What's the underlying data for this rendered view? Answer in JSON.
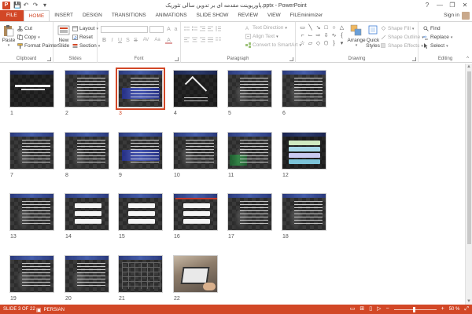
{
  "app": {
    "title": "پاورپوینت مقدمه ای بر تدوین سالی تئوریک.pptx - PowerPoint",
    "logo": "P",
    "signin": "Sign in"
  },
  "qat": {
    "save": "💾",
    "undo": "↶",
    "redo": "↷",
    "customize": "▾"
  },
  "window": {
    "help": "?",
    "minimize": "—",
    "restore": "❐",
    "close": "✕"
  },
  "tabs": [
    {
      "label": "FILE"
    },
    {
      "label": "HOME"
    },
    {
      "label": "INSERT"
    },
    {
      "label": "DESIGN"
    },
    {
      "label": "TRANSITIONS"
    },
    {
      "label": "ANIMATIONS"
    },
    {
      "label": "SLIDE SHOW"
    },
    {
      "label": "REVIEW"
    },
    {
      "label": "VIEW"
    },
    {
      "label": "FILEminimizer"
    }
  ],
  "ribbon": {
    "clipboard": {
      "label": "Clipboard",
      "paste": "Paste",
      "cut": "Cut",
      "copy": "Copy",
      "format_painter": "Format Painter"
    },
    "slides": {
      "label": "Slides",
      "new_slide": "New",
      "new_slide2": "Slide",
      "layout": "Layout",
      "reset": "Reset",
      "section": "Section"
    },
    "font": {
      "label": "Font",
      "bold": "B",
      "italic": "I",
      "underline": "U",
      "strike": "S",
      "shadow": "S",
      "spacing": "AV",
      "case": "Aa",
      "color": "A"
    },
    "paragraph": {
      "label": "Paragraph",
      "text_direction": "Text Direction",
      "align_text": "Align Text",
      "convert_smartart": "Convert to SmartArt"
    },
    "drawing": {
      "label": "Drawing",
      "arrange": "Arrange",
      "quick_styles": "Quick",
      "quick_styles2": "Styles",
      "shape_fill": "Shape Fill",
      "shape_outline": "Shape Outline",
      "shape_effects": "Shape Effects"
    },
    "editing": {
      "label": "Editing",
      "find": "Find",
      "replace": "Replace",
      "select": "Select"
    }
  },
  "slides": [
    {
      "num": "1",
      "kind": "title"
    },
    {
      "num": "2",
      "kind": "text"
    },
    {
      "num": "3",
      "kind": "text-blue",
      "selected": true
    },
    {
      "num": "4",
      "kind": "chevron"
    },
    {
      "num": "5",
      "kind": "text"
    },
    {
      "num": "6",
      "kind": "text"
    },
    {
      "num": "7",
      "kind": "text"
    },
    {
      "num": "8",
      "kind": "text"
    },
    {
      "num": "9",
      "kind": "text-blue"
    },
    {
      "num": "10",
      "kind": "text"
    },
    {
      "num": "11",
      "kind": "text-green"
    },
    {
      "num": "12",
      "kind": "stack-color"
    },
    {
      "num": "13",
      "kind": "text"
    },
    {
      "num": "14",
      "kind": "boxes"
    },
    {
      "num": "15",
      "kind": "boxes"
    },
    {
      "num": "16",
      "kind": "boxes-red"
    },
    {
      "num": "17",
      "kind": "text"
    },
    {
      "num": "18",
      "kind": "text"
    },
    {
      "num": "19",
      "kind": "text"
    },
    {
      "num": "20",
      "kind": "text"
    },
    {
      "num": "21",
      "kind": "table"
    },
    {
      "num": "22",
      "kind": "photo"
    }
  ],
  "status": {
    "slide": "SLIDE 3 OF 22",
    "language": "PERSIAN",
    "zoom": "50 %",
    "zoom_minus": "−",
    "zoom_plus": "+"
  }
}
